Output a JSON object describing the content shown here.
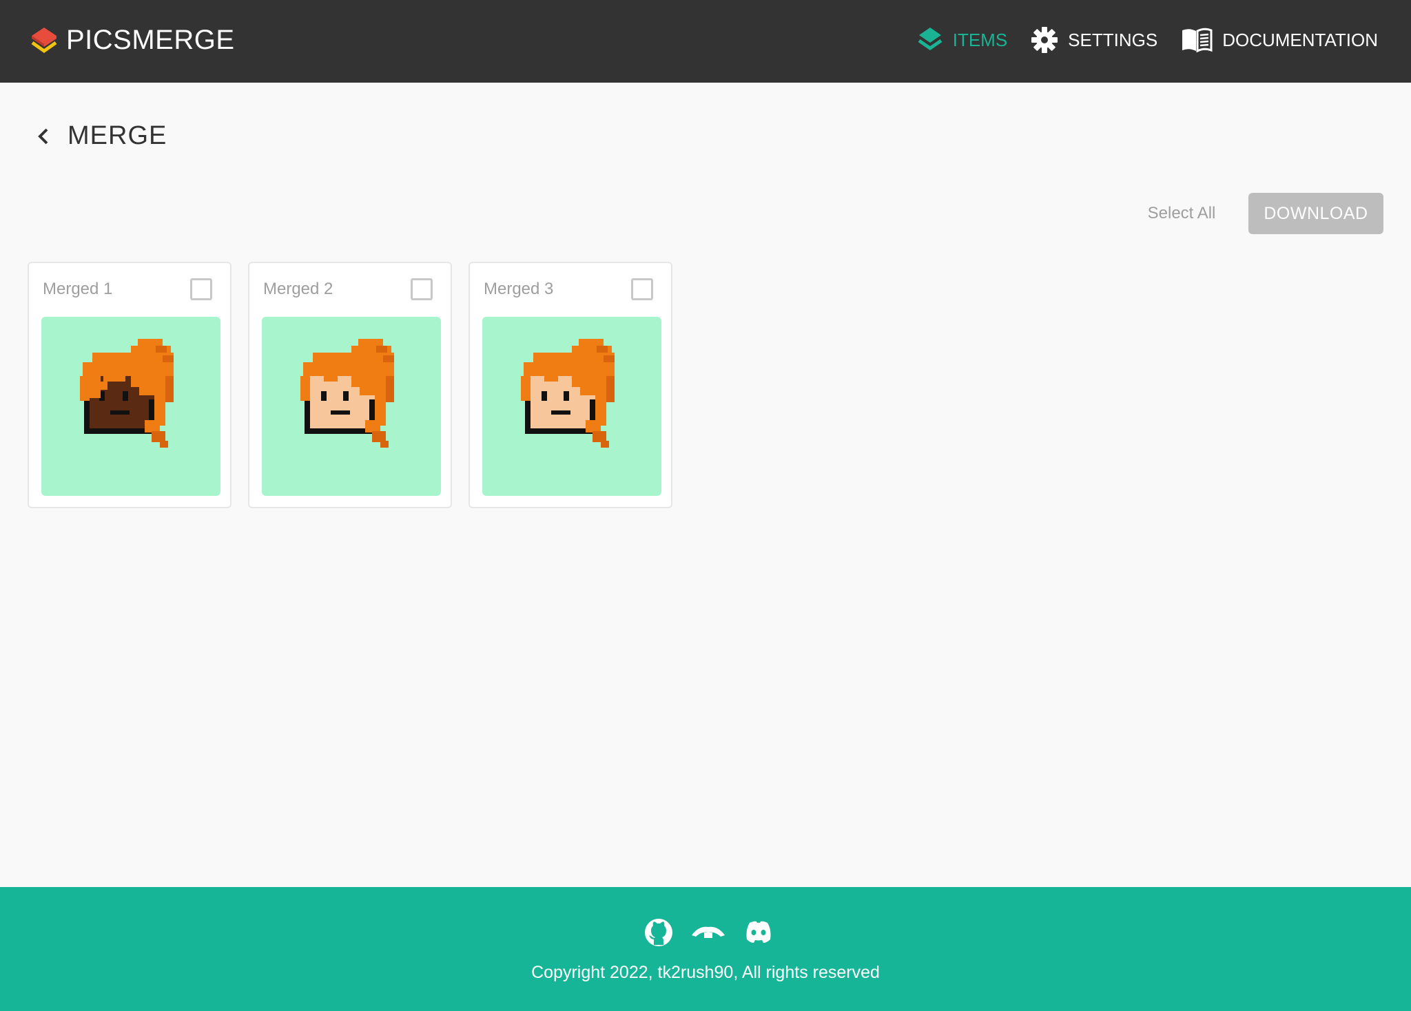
{
  "app": {
    "name": "PICSMERGE",
    "logo_icon": "layers-logo-icon"
  },
  "nav": {
    "items": [
      {
        "label": "ITEMS",
        "icon": "layers-icon",
        "active": true
      },
      {
        "label": "SETTINGS",
        "icon": "gear-icon",
        "active": false
      },
      {
        "label": "DOCUMENTATION",
        "icon": "book-icon",
        "active": false
      }
    ]
  },
  "page": {
    "title": "MERGE",
    "back_icon": "chevron-left-icon"
  },
  "actions": {
    "select_all": "Select All",
    "download": "DOWNLOAD"
  },
  "cards": [
    {
      "label": "Merged 1",
      "checked": false,
      "skin": "dark-brown"
    },
    {
      "label": "Merged 2",
      "checked": false,
      "skin": "light-peach"
    },
    {
      "label": "Merged 3",
      "checked": false,
      "skin": "light-peach"
    }
  ],
  "footer": {
    "icons": [
      "github-icon",
      "opensea-icon",
      "discord-icon"
    ],
    "copyright": "Copyright 2022, tk2rush90, All rights reserved"
  },
  "colors": {
    "header_bg": "#333333",
    "accent": "#1ab394",
    "footer_bg": "#16b597",
    "image_bg": "#a8f5cd",
    "hair": "#f07d14",
    "hair_shadow": "#d8650c"
  }
}
